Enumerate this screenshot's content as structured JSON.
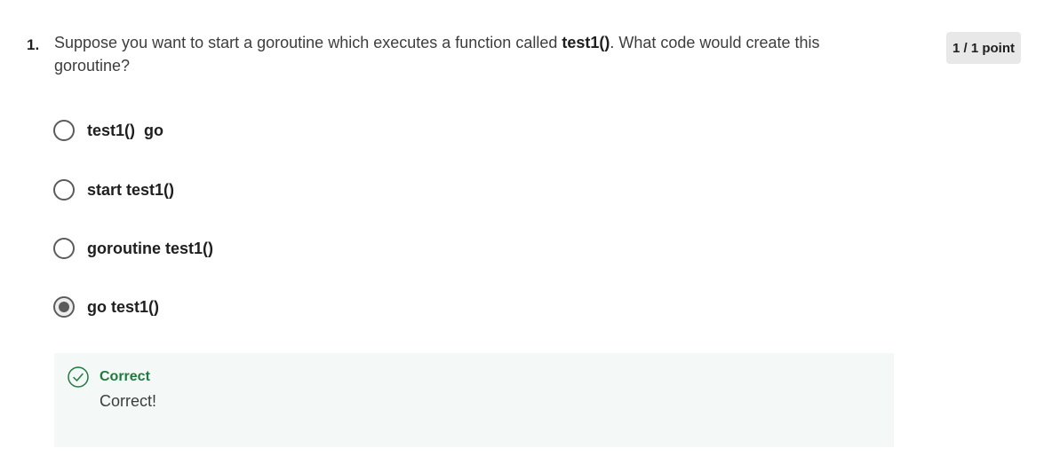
{
  "question": {
    "number": "1.",
    "text_before": "Suppose you want to start a goroutine which executes a function called ",
    "text_bold": "test1()",
    "text_after": ". What code would create this goroutine?",
    "score": "1 / 1 point"
  },
  "options": [
    {
      "label": "test1()  go",
      "selected": false
    },
    {
      "label": "start test1()",
      "selected": false
    },
    {
      "label": "goroutine test1()",
      "selected": false
    },
    {
      "label": "go test1()",
      "selected": true
    }
  ],
  "feedback": {
    "status": "Correct",
    "message": "Correct!",
    "icon": "check-circle-icon",
    "color": "#1e7b3f"
  },
  "colors": {
    "feedback_background": "#f4f8f6",
    "badge_background": "#e8e8e8",
    "radio_border": "#5b5b5b"
  }
}
